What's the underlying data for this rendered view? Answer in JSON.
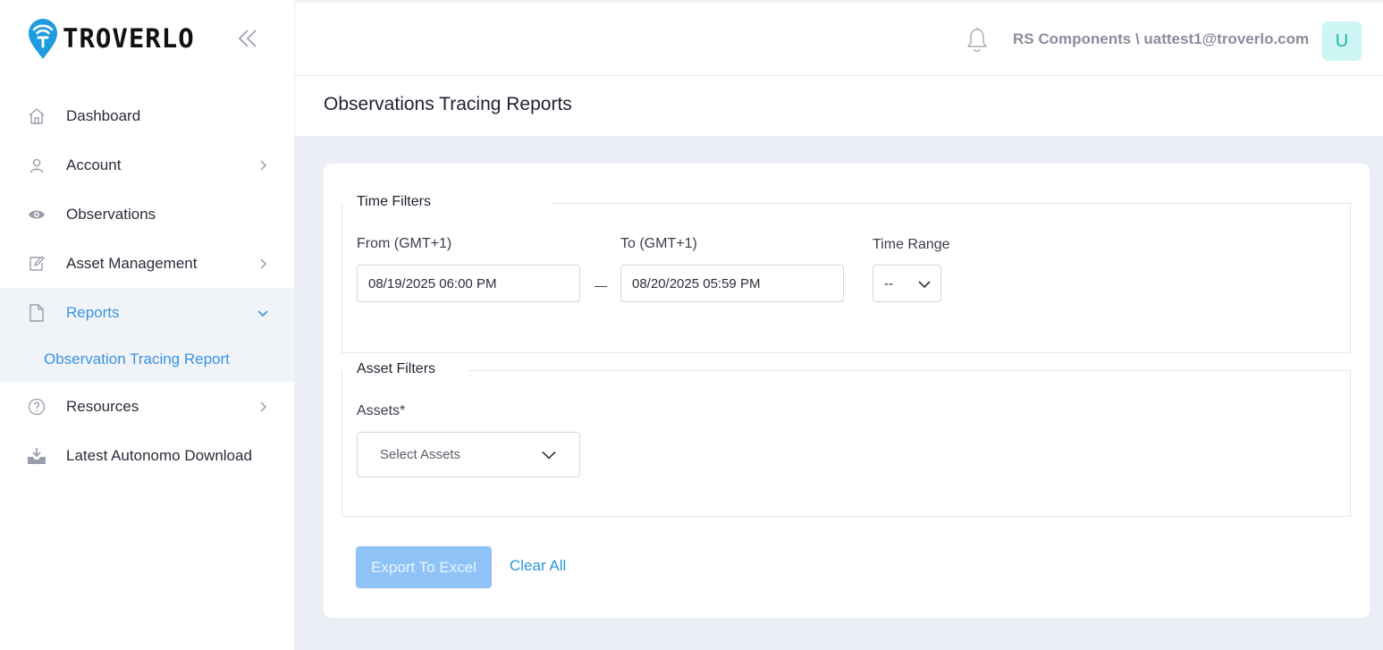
{
  "brand": {
    "name": "TROVERLO",
    "pin_color": "#1e9ce0"
  },
  "sidebar": {
    "items": [
      {
        "label": "Dashboard",
        "icon": "home-icon",
        "has_chevron": false
      },
      {
        "label": "Account",
        "icon": "user-icon",
        "has_chevron": true
      },
      {
        "label": "Observations",
        "icon": "eye-icon",
        "has_chevron": false
      },
      {
        "label": "Asset Management",
        "icon": "edit-icon",
        "has_chevron": true
      },
      {
        "label": "Reports",
        "icon": "document-icon",
        "has_chevron": true,
        "active": true
      },
      {
        "label": "Resources",
        "icon": "help-circle-icon",
        "has_chevron": true
      },
      {
        "label": "Latest Autonomo Download",
        "icon": "download-tray-icon",
        "has_chevron": false
      }
    ],
    "sub_items": [
      {
        "label": "Observation Tracing Report"
      }
    ],
    "active_color": "#3a93e0"
  },
  "header": {
    "user": "RS Components \\ uattest1@troverlo.com",
    "avatar_initial": "U"
  },
  "page": {
    "title": "Observations Tracing Reports"
  },
  "time_filters": {
    "legend": "Time Filters",
    "from_label": "From (GMT+1)",
    "from_value": "08/19/2025 06:00 PM",
    "to_label": "To (GMT+1)",
    "to_value": "08/20/2025 05:59 PM",
    "range_label": "Time Range",
    "range_value": "--"
  },
  "asset_filters": {
    "legend": "Asset Filters",
    "assets_label": "Assets*",
    "assets_placeholder": "Select Assets"
  },
  "actions": {
    "export_label": "Export To Excel",
    "clear_label": "Clear All"
  }
}
